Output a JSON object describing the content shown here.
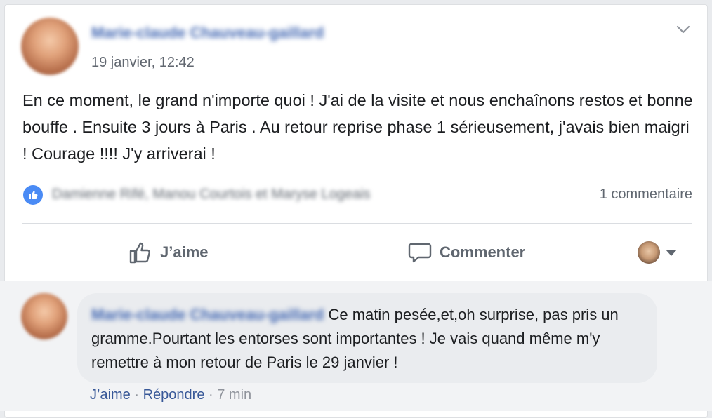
{
  "post": {
    "author": "Marie-claude Chauveau-gaillard",
    "timestamp": "19 janvier, 12:42",
    "text": "En ce moment, le grand n'importe quoi ! J'ai de la visite et nous enchaînons restos et bonne bouffe . Ensuite 3 jours à Paris . Au retour reprise phase 1 sérieusement, j'avais bien maigri ! Courage !!!! J'y arriverai !",
    "reactions_names": "Damienne Rifé, Manou Courtois et Maryse Logeais",
    "comment_count": "1 commentaire"
  },
  "actions": {
    "like_label": "J’aime",
    "comment_label": "Commenter"
  },
  "comment": {
    "author": "Marie-claude Chauveau-gaillard",
    "text": "Ce matin pesée,et,oh surprise, pas pris un gramme.Pourtant les entorses sont importantes ! Je vais quand même m'y remettre à mon retour de Paris le 29 janvier !",
    "like_link": "J’aime",
    "reply_link": "Répondre",
    "separator": "·",
    "time": "7 min"
  },
  "colors": {
    "link": "#385898",
    "like_badge": "#4a8bf5",
    "muted": "#606770"
  },
  "icons": [
    "chevron-down-icon",
    "thumbs-up-icon",
    "comment-bubble-icon",
    "caret-down-icon"
  ]
}
